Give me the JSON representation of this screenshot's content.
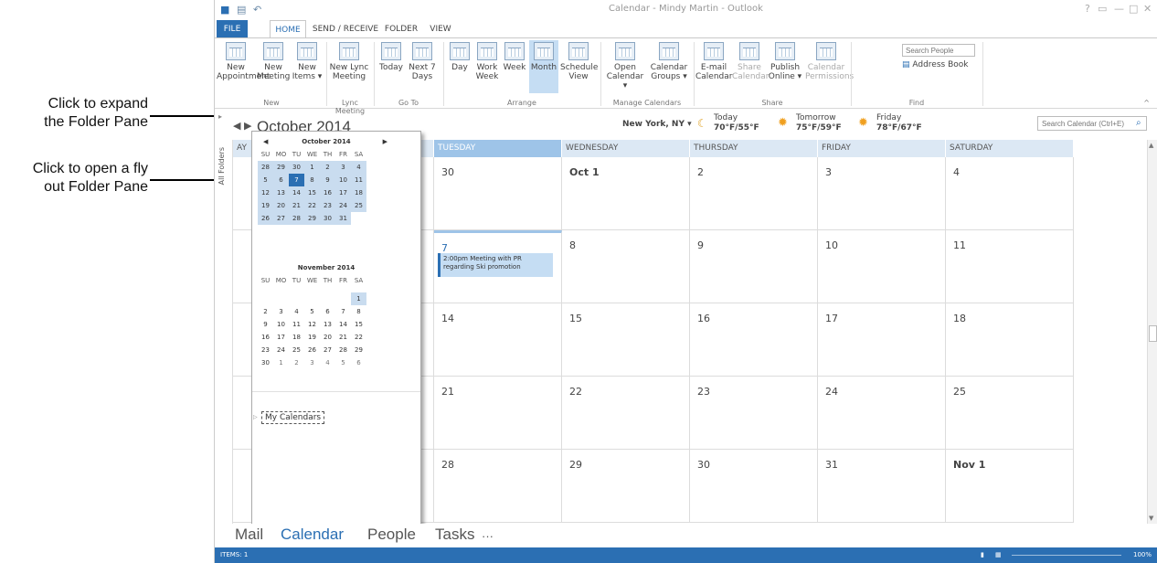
{
  "callouts": {
    "expand": "Click to expand\nthe Folder Pane",
    "flyout": "Click to open a fly\nout Folder Pane"
  },
  "window": {
    "title": "Calendar - Mindy Martin - Outlook"
  },
  "tabs": [
    "FILE",
    "HOME",
    "SEND / RECEIVE",
    "FOLDER",
    "VIEW"
  ],
  "ribbon": {
    "new_appointment": "New\nAppointment",
    "new_meeting": "New\nMeeting",
    "new_items": "New\nItems ▾",
    "new_lync": "New Lync\nMeeting",
    "today": "Today",
    "next7": "Next 7\nDays",
    "day": "Day",
    "workweek": "Work\nWeek",
    "week": "Week",
    "month": "Month",
    "schedule": "Schedule\nView",
    "open_cal": "Open\nCalendar ▾",
    "cal_groups": "Calendar\nGroups ▾",
    "email_cal": "E-mail\nCalendar",
    "share_cal": "Share\nCalendar",
    "publish": "Publish\nOnline ▾",
    "cal_perm": "Calendar\nPermissions",
    "search_people": "Search People",
    "address_book": "Address Book",
    "groups": {
      "new": "New",
      "lync": "Lync Meeting",
      "goto": "Go To",
      "arrange": "Arrange",
      "manage": "Manage Calendars",
      "share": "Share",
      "find": "Find"
    }
  },
  "nav": {
    "month_title": "October 2014",
    "location": "New York, NY ▾",
    "today_label": "Today",
    "today_temp": "70°F/55°F",
    "tomorrow_label": "Tomorrow",
    "tomorrow_temp": "75°F/59°F",
    "friday_label": "Friday",
    "friday_temp": "78°F/67°F",
    "search_placeholder": "Search Calendar (Ctrl+E)"
  },
  "folder_strip": "All Folders",
  "days": [
    "AY",
    "TUESDAY",
    "WEDNESDAY",
    "THURSDAY",
    "FRIDAY",
    "SATURDAY"
  ],
  "weeks": [
    [
      "",
      "30",
      "Oct 1",
      "2",
      "3",
      "4"
    ],
    [
      "",
      "7",
      "8",
      "9",
      "10",
      "11"
    ],
    [
      "",
      "14",
      "15",
      "16",
      "17",
      "18"
    ],
    [
      "",
      "21",
      "22",
      "23",
      "24",
      "25"
    ],
    [
      "",
      "28",
      "29",
      "30",
      "31",
      "Nov 1"
    ]
  ],
  "event": "2:00pm Meeting with PR regarding Ski promotion",
  "mini_oct": {
    "title": "October 2014",
    "weekdays": [
      "SU",
      "MO",
      "TU",
      "WE",
      "TH",
      "FR",
      "SA"
    ],
    "rows": [
      [
        "28",
        "29",
        "30",
        "1",
        "2",
        "3",
        "4"
      ],
      [
        "5",
        "6",
        "7",
        "8",
        "9",
        "10",
        "11"
      ],
      [
        "12",
        "13",
        "14",
        "15",
        "16",
        "17",
        "18"
      ],
      [
        "19",
        "20",
        "21",
        "22",
        "23",
        "24",
        "25"
      ],
      [
        "26",
        "27",
        "28",
        "29",
        "30",
        "31",
        ""
      ]
    ]
  },
  "mini_nov": {
    "title": "November 2014",
    "weekdays": [
      "SU",
      "MO",
      "TU",
      "WE",
      "TH",
      "FR",
      "SA"
    ],
    "rows": [
      [
        "",
        "",
        "",
        "",
        "",
        "",
        "1"
      ],
      [
        "2",
        "3",
        "4",
        "5",
        "6",
        "7",
        "8"
      ],
      [
        "9",
        "10",
        "11",
        "12",
        "13",
        "14",
        "15"
      ],
      [
        "16",
        "17",
        "18",
        "19",
        "20",
        "21",
        "22"
      ],
      [
        "23",
        "24",
        "25",
        "26",
        "27",
        "28",
        "29"
      ],
      [
        "30",
        "1",
        "2",
        "3",
        "4",
        "5",
        "6"
      ]
    ]
  },
  "my_calendars": "My Calendars",
  "modules": [
    "Mail",
    "Calendar",
    "People",
    "Tasks",
    "···"
  ],
  "status": {
    "items": "ITEMS: 1",
    "zoom": "100%"
  }
}
